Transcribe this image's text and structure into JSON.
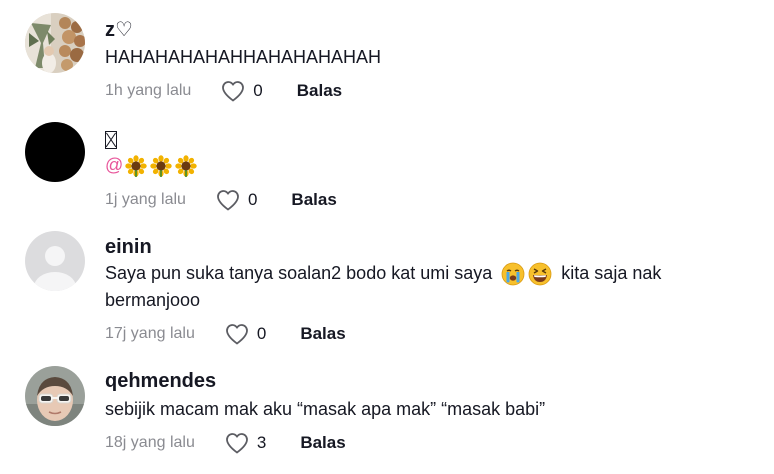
{
  "comments": [
    {
      "username": "z♡",
      "text": "HAHAHAHAHAHHAHAHAHAHAH",
      "time": "1h yang lalu",
      "likes": "0",
      "reply_label": "Balas",
      "avatar": "photo-avatar-plants"
    },
    {
      "username": "",
      "username_glyph": "missing-glyph-box",
      "mention_symbol": "@",
      "emojis": [
        "sunflower",
        "sunflower",
        "sunflower"
      ],
      "time": "1j yang lalu",
      "likes": "0",
      "reply_label": "Balas",
      "avatar": "black-avatar"
    },
    {
      "username": "einin",
      "text_line1": "Saya pun suka tanya soalan2 bodo kat umi saya",
      "emojis": [
        "loudly-crying-face",
        "grinning-squinting-face"
      ],
      "text_line1_after": "kita saja nak",
      "text_line2": "bermanjooo",
      "time": "17j yang lalu",
      "likes": "0",
      "reply_label": "Balas",
      "avatar": "default-avatar"
    },
    {
      "username": "qehmendes",
      "text": "sebijik macam mak aku “masak apa mak” “masak babi”",
      "time": "18j yang lalu",
      "likes": "3",
      "reply_label": "Balas",
      "avatar": "photo-avatar-sunglasses"
    }
  ],
  "colors": {
    "primary_text": "#161823",
    "secondary_text": "#8a8b91",
    "mention": "#e8559a",
    "background": "#ffffff"
  },
  "icons": {
    "like": "heart-outline-icon"
  }
}
